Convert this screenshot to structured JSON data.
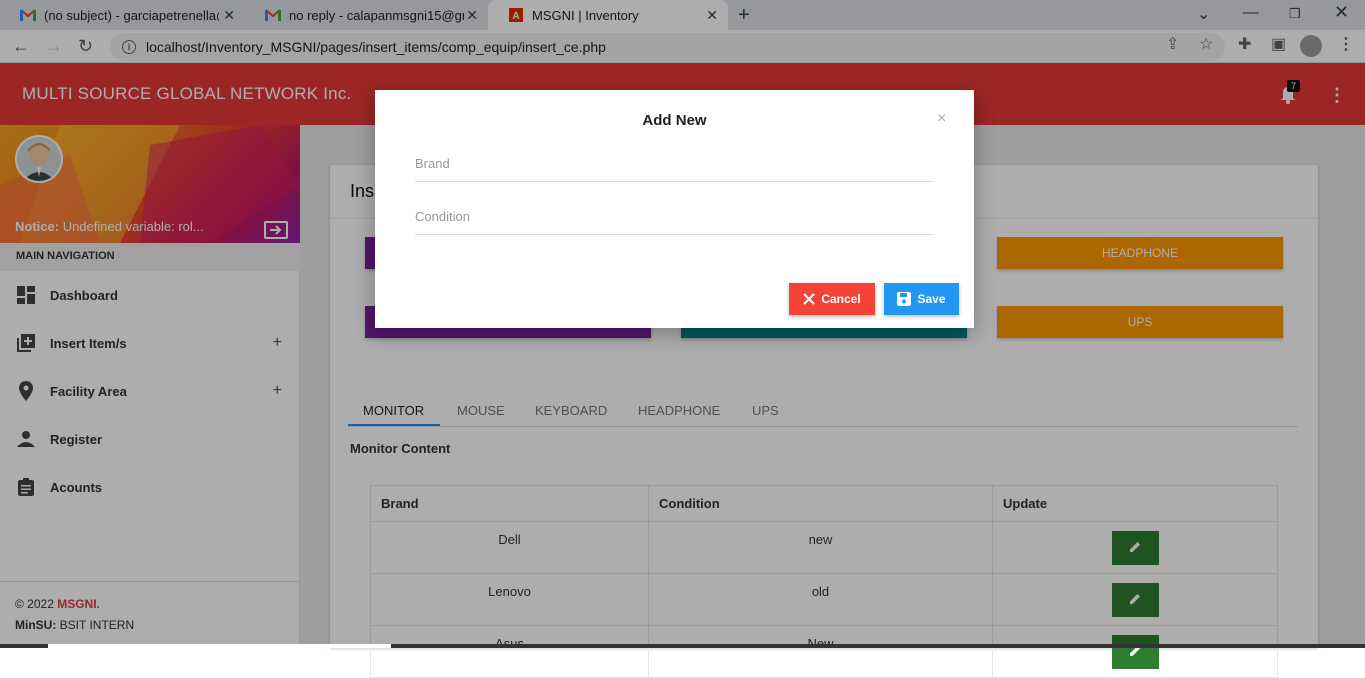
{
  "browser": {
    "tabs": [
      {
        "title": "(no subject) - garciapetrenella@g",
        "active": false
      },
      {
        "title": "no reply - calapanmsgni15@gma",
        "active": false
      },
      {
        "title": "MSGNI | Inventory",
        "active": true
      }
    ],
    "url": "localhost/Inventory_MSGNI/pages/insert_items/comp_equip/insert_ce.php"
  },
  "topbar": {
    "brand": "MULTI SOURCE GLOBAL NETWORK Inc.",
    "notification_count": "7",
    "accent_color": "#e53935"
  },
  "sidebar": {
    "notice_label": "Notice:",
    "notice_text": "Undefined variable: rol...",
    "section": "MAIN NAVIGATION",
    "items": [
      {
        "label": "Dashboard",
        "icon": "dashboard-icon",
        "expandable": false
      },
      {
        "label": "Insert Item/s",
        "icon": "add-box-icon",
        "expandable": true
      },
      {
        "label": "Facility Area",
        "icon": "location-pin-icon",
        "expandable": true
      },
      {
        "label": "Register",
        "icon": "person-icon",
        "expandable": false
      },
      {
        "label": "Acounts",
        "icon": "clipboard-icon",
        "expandable": false
      }
    ],
    "footer_copy": "© 2022",
    "footer_brand": "MSGNI.",
    "footer_org": "MinSU:",
    "footer_role": "BSIT INTERN"
  },
  "main": {
    "heading": "Ins",
    "tiles": [
      {
        "label": "",
        "color": "#7b1fa2"
      },
      {
        "label": "HEADPHONE",
        "color": "#ff9800"
      },
      {
        "label": "",
        "color": "#7b1fa2"
      },
      {
        "label": "",
        "color": "#00838f"
      },
      {
        "label": "UPS",
        "color": "#ff9800"
      }
    ],
    "tabs": [
      "MONITOR",
      "MOUSE",
      "KEYBOARD",
      "HEADPHONE",
      "UPS"
    ],
    "content_title": "Monitor Content",
    "table": {
      "headers": [
        "Brand",
        "Condition",
        "Update"
      ],
      "rows": [
        {
          "brand": "Dell",
          "condition": "new"
        },
        {
          "brand": "Lenovo",
          "condition": "old"
        },
        {
          "brand": "Asus",
          "condition": "New"
        }
      ]
    }
  },
  "modal": {
    "title": "Add New",
    "close": "×",
    "brand_placeholder": "Brand",
    "condition_placeholder": "Condition",
    "cancel_label": "Cancel",
    "save_label": "Save",
    "cancel_color": "#f44336",
    "save_color": "#2196f3"
  }
}
